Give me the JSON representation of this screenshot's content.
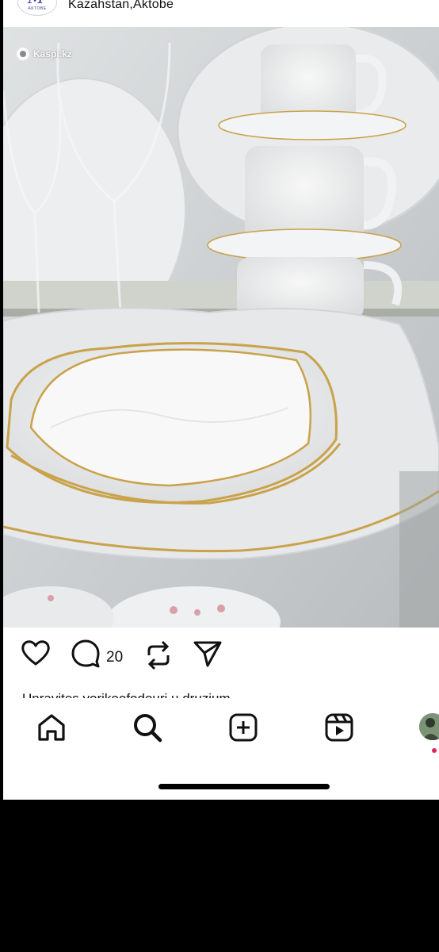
{
  "header": {
    "location": "Kazahstan,Aktobe",
    "avatar_logo_text": "M",
    "avatar_logo_subtext": "AKTOBE"
  },
  "media": {
    "watermark": "Kaspi.kz",
    "watermark_icon": "kaspi-logo-icon"
  },
  "actions": {
    "like_icon": "heart-icon",
    "comment_icon": "comment-bubble-icon",
    "comment_count": "20",
    "repost_icon": "repost-icon",
    "share_icon": "send-icon"
  },
  "caption_peek": "Unravites vorikoofodouri u druzium",
  "tabbar": {
    "items": [
      {
        "icon": "home-icon"
      },
      {
        "icon": "search-icon"
      },
      {
        "icon": "create-plus-icon"
      },
      {
        "icon": "reels-icon"
      },
      {
        "icon": "profile-avatar"
      }
    ]
  },
  "colors": {
    "background": "#000000",
    "screen": "#ffffff",
    "icon": "#111111",
    "notification_dot": "#e0245e",
    "porcelain_gold_rim": "#c9a24a"
  }
}
